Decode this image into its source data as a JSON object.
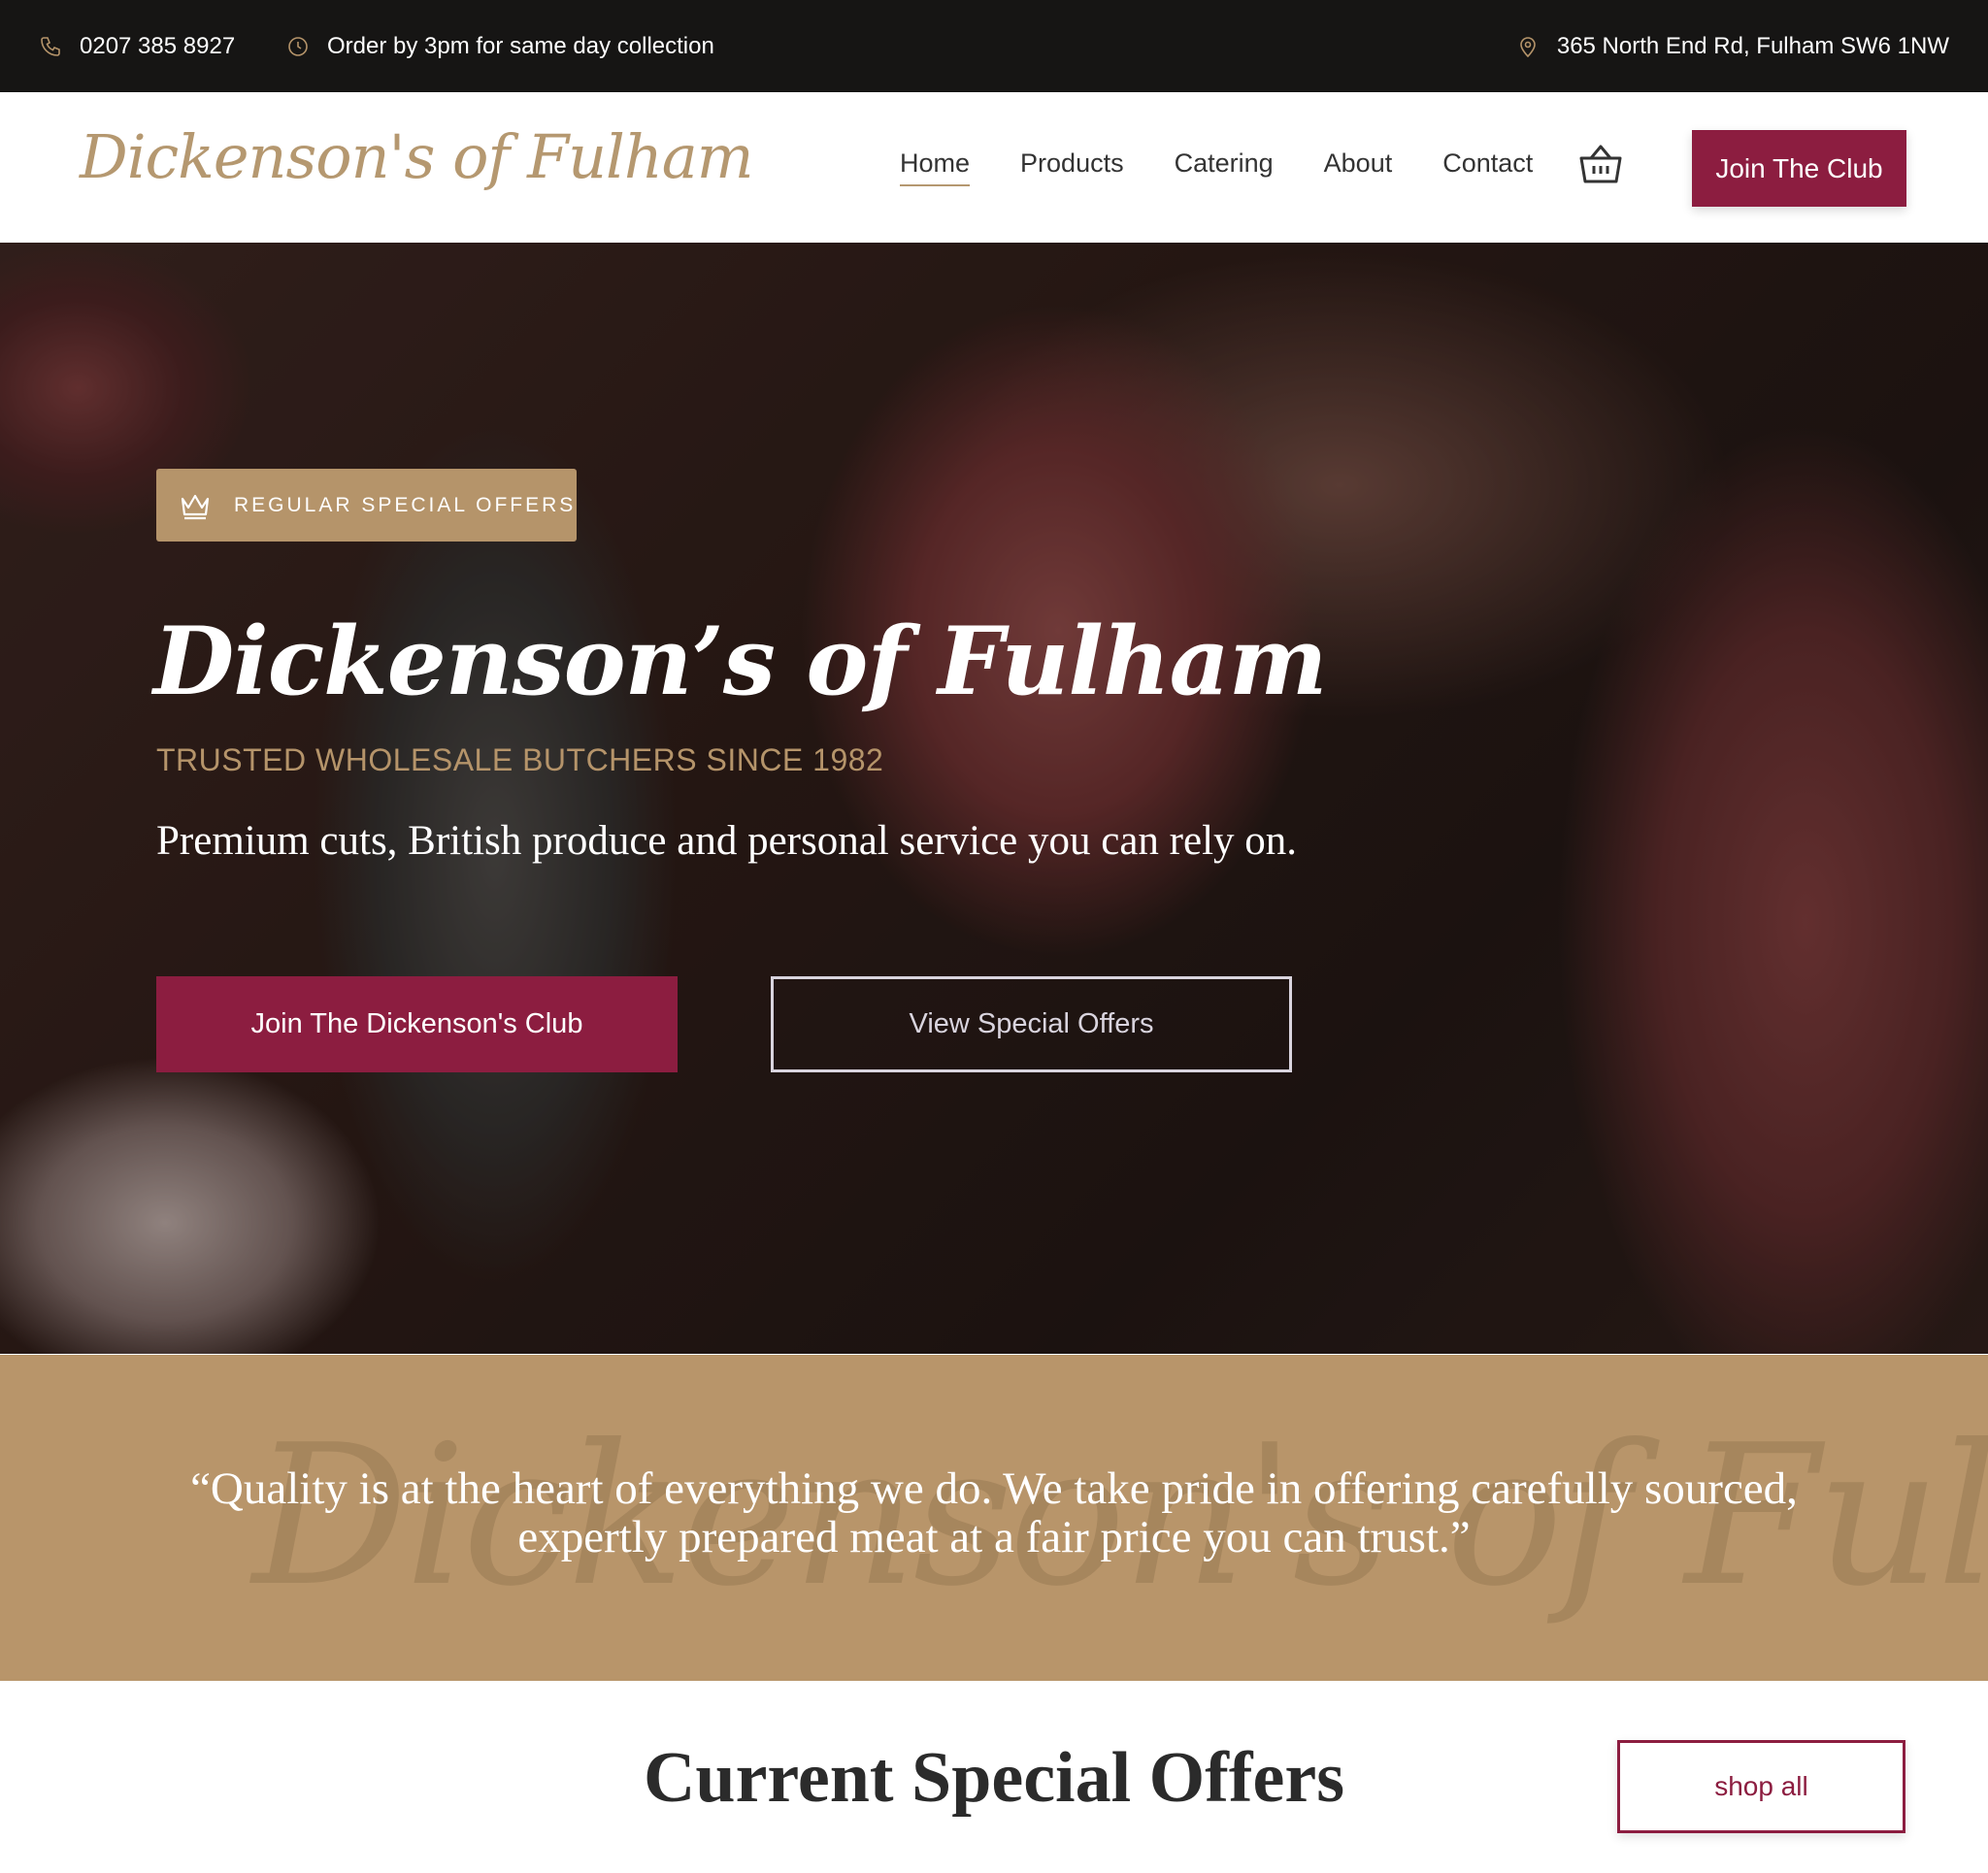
{
  "topbar": {
    "phone": "0207 385 8927",
    "order_note": "Order by 3pm for same day collection",
    "address": "365 North End Rd, Fulham SW6 1NW"
  },
  "header": {
    "logo": "Dickenson's of Fulham",
    "nav": [
      "Home",
      "Products",
      "Catering",
      "About",
      "Contact"
    ],
    "active_nav": "Home",
    "join_button": "Join The Club"
  },
  "hero": {
    "badge": "REGULAR SPECIAL OFFERS",
    "title": "Dickenson’s of Fulham",
    "subtitle": "TRUSTED WHOLESALE BUTCHERS SINCE 1982",
    "description": "Premium cuts, British produce and personal service you can rely on.",
    "primary_button": "Join The Dickenson's Club",
    "secondary_button": "View Special Offers"
  },
  "quote": {
    "watermark": "Dickenson's of Fulham",
    "line1": "“Quality is at the heart of everything we do. We take pride in offering carefully sourced,",
    "line2": "expertly prepared meat at a fair price you can trust.”"
  },
  "offers": {
    "title": "Current Special Offers",
    "shop_all": "shop all"
  },
  "colors": {
    "brand": "#8c1d40",
    "gold": "#b5946a",
    "topbar": "#161514",
    "band": "#b8956a"
  }
}
